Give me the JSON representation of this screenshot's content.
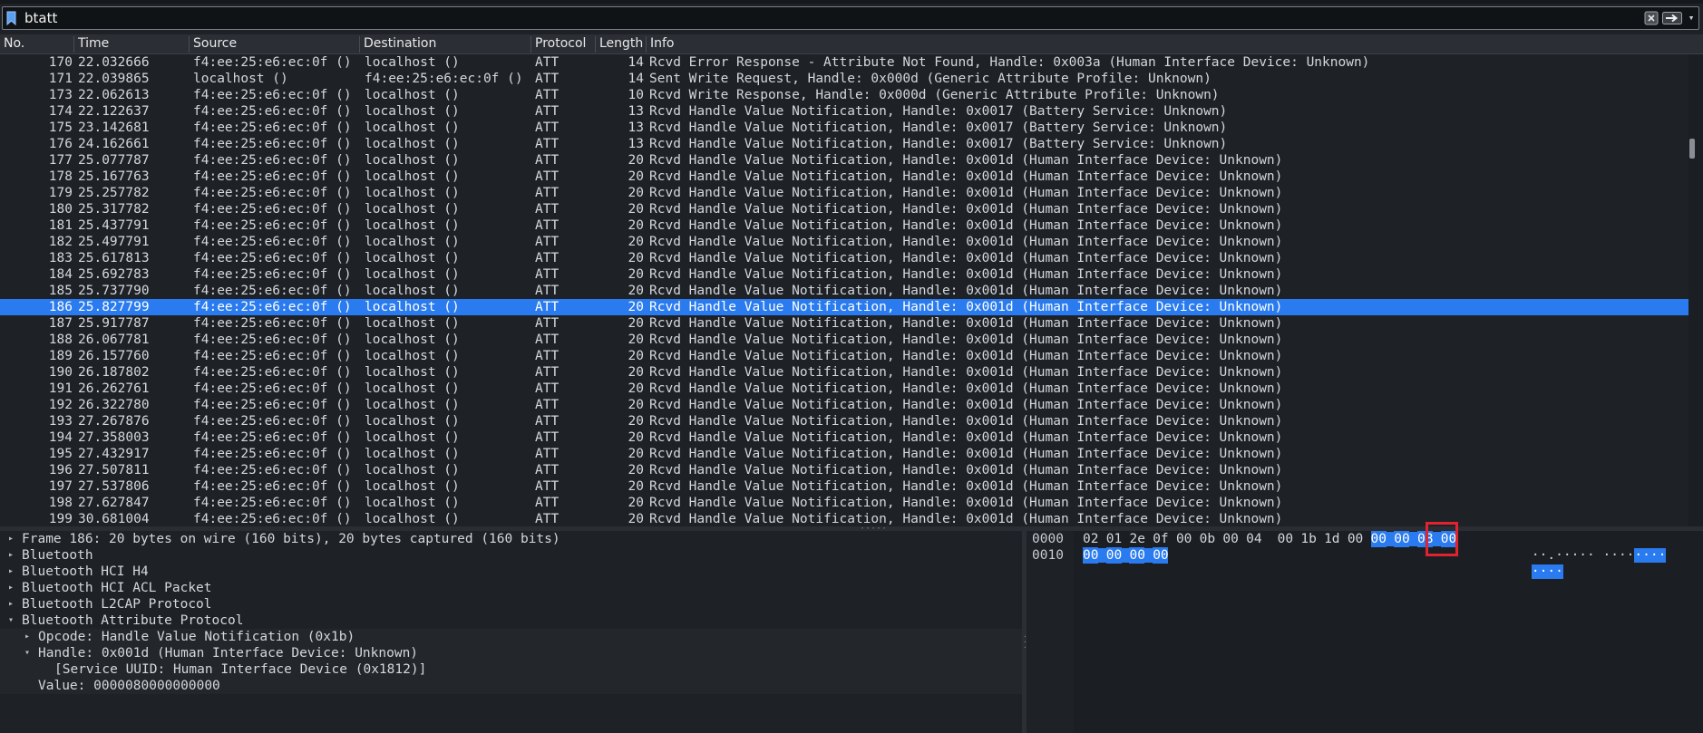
{
  "filter": {
    "value": "btatt"
  },
  "columns": [
    "No.",
    "Time",
    "Source",
    "Destination",
    "Protocol",
    "Length",
    "Info"
  ],
  "packets": [
    {
      "no": "170",
      "time": "22.032666",
      "src": "f4:ee:25:e6:ec:0f ()",
      "dst": "localhost ()",
      "proto": "ATT",
      "len": "14",
      "info": "Rcvd Error Response - Attribute Not Found, Handle: 0x003a (Human Interface Device: Unknown)"
    },
    {
      "no": "171",
      "time": "22.039865",
      "src": "localhost ()",
      "dst": "f4:ee:25:e6:ec:0f ()",
      "proto": "ATT",
      "len": "14",
      "info": "Sent Write Request, Handle: 0x000d (Generic Attribute Profile: Unknown)"
    },
    {
      "no": "173",
      "time": "22.062613",
      "src": "f4:ee:25:e6:ec:0f ()",
      "dst": "localhost ()",
      "proto": "ATT",
      "len": "10",
      "info": "Rcvd Write Response, Handle: 0x000d (Generic Attribute Profile: Unknown)"
    },
    {
      "no": "174",
      "time": "22.122637",
      "src": "f4:ee:25:e6:ec:0f ()",
      "dst": "localhost ()",
      "proto": "ATT",
      "len": "13",
      "info": "Rcvd Handle Value Notification, Handle: 0x0017 (Battery Service: Unknown)"
    },
    {
      "no": "175",
      "time": "23.142681",
      "src": "f4:ee:25:e6:ec:0f ()",
      "dst": "localhost ()",
      "proto": "ATT",
      "len": "13",
      "info": "Rcvd Handle Value Notification, Handle: 0x0017 (Battery Service: Unknown)"
    },
    {
      "no": "176",
      "time": "24.162661",
      "src": "f4:ee:25:e6:ec:0f ()",
      "dst": "localhost ()",
      "proto": "ATT",
      "len": "13",
      "info": "Rcvd Handle Value Notification, Handle: 0x0017 (Battery Service: Unknown)"
    },
    {
      "no": "177",
      "time": "25.077787",
      "src": "f4:ee:25:e6:ec:0f ()",
      "dst": "localhost ()",
      "proto": "ATT",
      "len": "20",
      "info": "Rcvd Handle Value Notification, Handle: 0x001d (Human Interface Device: Unknown)"
    },
    {
      "no": "178",
      "time": "25.167763",
      "src": "f4:ee:25:e6:ec:0f ()",
      "dst": "localhost ()",
      "proto": "ATT",
      "len": "20",
      "info": "Rcvd Handle Value Notification, Handle: 0x001d (Human Interface Device: Unknown)"
    },
    {
      "no": "179",
      "time": "25.257782",
      "src": "f4:ee:25:e6:ec:0f ()",
      "dst": "localhost ()",
      "proto": "ATT",
      "len": "20",
      "info": "Rcvd Handle Value Notification, Handle: 0x001d (Human Interface Device: Unknown)"
    },
    {
      "no": "180",
      "time": "25.317782",
      "src": "f4:ee:25:e6:ec:0f ()",
      "dst": "localhost ()",
      "proto": "ATT",
      "len": "20",
      "info": "Rcvd Handle Value Notification, Handle: 0x001d (Human Interface Device: Unknown)"
    },
    {
      "no": "181",
      "time": "25.437791",
      "src": "f4:ee:25:e6:ec:0f ()",
      "dst": "localhost ()",
      "proto": "ATT",
      "len": "20",
      "info": "Rcvd Handle Value Notification, Handle: 0x001d (Human Interface Device: Unknown)"
    },
    {
      "no": "182",
      "time": "25.497791",
      "src": "f4:ee:25:e6:ec:0f ()",
      "dst": "localhost ()",
      "proto": "ATT",
      "len": "20",
      "info": "Rcvd Handle Value Notification, Handle: 0x001d (Human Interface Device: Unknown)"
    },
    {
      "no": "183",
      "time": "25.617813",
      "src": "f4:ee:25:e6:ec:0f ()",
      "dst": "localhost ()",
      "proto": "ATT",
      "len": "20",
      "info": "Rcvd Handle Value Notification, Handle: 0x001d (Human Interface Device: Unknown)"
    },
    {
      "no": "184",
      "time": "25.692783",
      "src": "f4:ee:25:e6:ec:0f ()",
      "dst": "localhost ()",
      "proto": "ATT",
      "len": "20",
      "info": "Rcvd Handle Value Notification, Handle: 0x001d (Human Interface Device: Unknown)"
    },
    {
      "no": "185",
      "time": "25.737790",
      "src": "f4:ee:25:e6:ec:0f ()",
      "dst": "localhost ()",
      "proto": "ATT",
      "len": "20",
      "info": "Rcvd Handle Value Notification, Handle: 0x001d (Human Interface Device: Unknown)"
    },
    {
      "no": "186",
      "time": "25.827799",
      "src": "f4:ee:25:e6:ec:0f ()",
      "dst": "localhost ()",
      "proto": "ATT",
      "len": "20",
      "info": "Rcvd Handle Value Notification, Handle: 0x001d (Human Interface Device: Unknown)",
      "selected": true
    },
    {
      "no": "187",
      "time": "25.917787",
      "src": "f4:ee:25:e6:ec:0f ()",
      "dst": "localhost ()",
      "proto": "ATT",
      "len": "20",
      "info": "Rcvd Handle Value Notification, Handle: 0x001d (Human Interface Device: Unknown)"
    },
    {
      "no": "188",
      "time": "26.067781",
      "src": "f4:ee:25:e6:ec:0f ()",
      "dst": "localhost ()",
      "proto": "ATT",
      "len": "20",
      "info": "Rcvd Handle Value Notification, Handle: 0x001d (Human Interface Device: Unknown)"
    },
    {
      "no": "189",
      "time": "26.157760",
      "src": "f4:ee:25:e6:ec:0f ()",
      "dst": "localhost ()",
      "proto": "ATT",
      "len": "20",
      "info": "Rcvd Handle Value Notification, Handle: 0x001d (Human Interface Device: Unknown)"
    },
    {
      "no": "190",
      "time": "26.187802",
      "src": "f4:ee:25:e6:ec:0f ()",
      "dst": "localhost ()",
      "proto": "ATT",
      "len": "20",
      "info": "Rcvd Handle Value Notification, Handle: 0x001d (Human Interface Device: Unknown)"
    },
    {
      "no": "191",
      "time": "26.262761",
      "src": "f4:ee:25:e6:ec:0f ()",
      "dst": "localhost ()",
      "proto": "ATT",
      "len": "20",
      "info": "Rcvd Handle Value Notification, Handle: 0x001d (Human Interface Device: Unknown)"
    },
    {
      "no": "192",
      "time": "26.322780",
      "src": "f4:ee:25:e6:ec:0f ()",
      "dst": "localhost ()",
      "proto": "ATT",
      "len": "20",
      "info": "Rcvd Handle Value Notification, Handle: 0x001d (Human Interface Device: Unknown)"
    },
    {
      "no": "193",
      "time": "27.267876",
      "src": "f4:ee:25:e6:ec:0f ()",
      "dst": "localhost ()",
      "proto": "ATT",
      "len": "20",
      "info": "Rcvd Handle Value Notification, Handle: 0x001d (Human Interface Device: Unknown)"
    },
    {
      "no": "194",
      "time": "27.358003",
      "src": "f4:ee:25:e6:ec:0f ()",
      "dst": "localhost ()",
      "proto": "ATT",
      "len": "20",
      "info": "Rcvd Handle Value Notification, Handle: 0x001d (Human Interface Device: Unknown)"
    },
    {
      "no": "195",
      "time": "27.432917",
      "src": "f4:ee:25:e6:ec:0f ()",
      "dst": "localhost ()",
      "proto": "ATT",
      "len": "20",
      "info": "Rcvd Handle Value Notification, Handle: 0x001d (Human Interface Device: Unknown)"
    },
    {
      "no": "196",
      "time": "27.507811",
      "src": "f4:ee:25:e6:ec:0f ()",
      "dst": "localhost ()",
      "proto": "ATT",
      "len": "20",
      "info": "Rcvd Handle Value Notification, Handle: 0x001d (Human Interface Device: Unknown)"
    },
    {
      "no": "197",
      "time": "27.537806",
      "src": "f4:ee:25:e6:ec:0f ()",
      "dst": "localhost ()",
      "proto": "ATT",
      "len": "20",
      "info": "Rcvd Handle Value Notification, Handle: 0x001d (Human Interface Device: Unknown)"
    },
    {
      "no": "198",
      "time": "27.627847",
      "src": "f4:ee:25:e6:ec:0f ()",
      "dst": "localhost ()",
      "proto": "ATT",
      "len": "20",
      "info": "Rcvd Handle Value Notification, Handle: 0x001d (Human Interface Device: Unknown)"
    },
    {
      "no": "199",
      "time": "30.681004",
      "src": "f4:ee:25:e6:ec:0f ()",
      "dst": "localhost ()",
      "proto": "ATT",
      "len": "20",
      "info": "Rcvd Handle Value Notification, Handle: 0x001d (Human Interface Device: Unknown)"
    }
  ],
  "details": [
    {
      "text": "Frame 186: 20 bytes on wire (160 bits), 20 bytes captured (160 bits)",
      "level": 0,
      "arrow": "collapsed"
    },
    {
      "text": "Bluetooth",
      "level": 0,
      "arrow": "collapsed"
    },
    {
      "text": "Bluetooth HCI H4",
      "level": 0,
      "arrow": "collapsed"
    },
    {
      "text": "Bluetooth HCI ACL Packet",
      "level": 0,
      "arrow": "collapsed"
    },
    {
      "text": "Bluetooth L2CAP Protocol",
      "level": 0,
      "arrow": "collapsed"
    },
    {
      "text": "Bluetooth Attribute Protocol",
      "level": 0,
      "arrow": "expanded"
    },
    {
      "text": "Opcode: Handle Value Notification (0x1b)",
      "level": 1,
      "arrow": "collapsed"
    },
    {
      "text": "Handle: 0x001d (Human Interface Device: Unknown)",
      "level": 1,
      "arrow": "expanded"
    },
    {
      "text": "[Service UUID: Human Interface Device (0x1812)]",
      "level": 2,
      "arrow": "none"
    },
    {
      "text": "Value: 0000080000000000",
      "level": 1,
      "arrow": "none"
    }
  ],
  "bytes": {
    "offsets": [
      "0000",
      "0010"
    ],
    "rows": [
      {
        "hex": [
          "02",
          "01",
          "2e",
          "0f",
          "00",
          "0b",
          "00",
          "04",
          "00",
          "1b",
          "1d",
          "00",
          "00",
          "00",
          "08",
          "00"
        ],
        "ascii_plain": "··.····· ····",
        "ascii_hl": "····"
      },
      {
        "hex": [
          "00",
          "00",
          "00",
          "00"
        ],
        "ascii_plain": "",
        "ascii_hl": "····"
      }
    ],
    "highlighted_from_row0": 12
  }
}
